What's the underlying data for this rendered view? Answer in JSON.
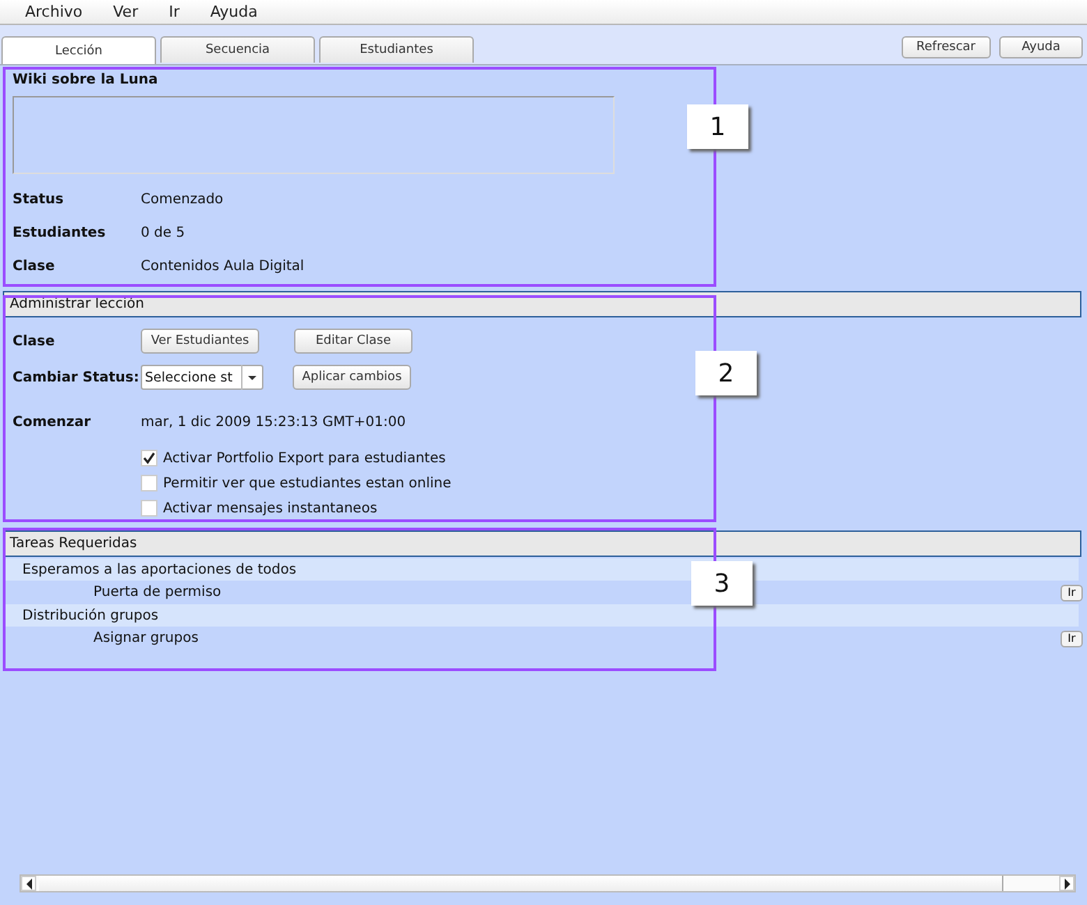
{
  "menu": [
    "Archivo",
    "Ver",
    "Ir",
    "Ayuda"
  ],
  "tabs": [
    {
      "label": "Lección",
      "selected": true
    },
    {
      "label": "Secuencia",
      "selected": false
    },
    {
      "label": "Estudiantes",
      "selected": false
    }
  ],
  "toolbar_buttons": [
    "Refrescar",
    "Ayuda"
  ],
  "lesson": {
    "title": "Wiki sobre la Luna",
    "fields": [
      {
        "label": "Status",
        "value": "Comenzado"
      },
      {
        "label": "Estudiantes",
        "value": "0 de 5"
      },
      {
        "label": "Clase",
        "value": "Contenidos Aula Digital"
      }
    ]
  },
  "manage": {
    "header": "Administrar lección",
    "class_label": "Clase",
    "class_buttons": [
      "Ver Estudiantes",
      "Editar Clase"
    ],
    "status_label": "Cambiar Status:",
    "status_select": "Seleccione st",
    "apply_button": "Aplicar cambios",
    "start_label": "Comenzar",
    "start_value": "mar, 1 dic 2009 15:23:13 GMT+01:00",
    "options": [
      {
        "label": "Activar Portfolio Export para estudiantes",
        "checked": true
      },
      {
        "label": "Permitir ver que estudiantes estan online",
        "checked": false
      },
      {
        "label": "Activar mensajes instantaneos",
        "checked": false
      }
    ]
  },
  "tasks": {
    "header": "Tareas Requeridas",
    "groups": [
      {
        "title": "Esperamos a las aportaciones de todos",
        "children": [
          {
            "title": "Puerta de permiso",
            "button": "Ir"
          }
        ]
      },
      {
        "title": "Distribución grupos",
        "children": [
          {
            "title": "Asignar grupos",
            "button": "Ir"
          }
        ]
      }
    ]
  },
  "callouts": [
    "1",
    "2",
    "3"
  ]
}
